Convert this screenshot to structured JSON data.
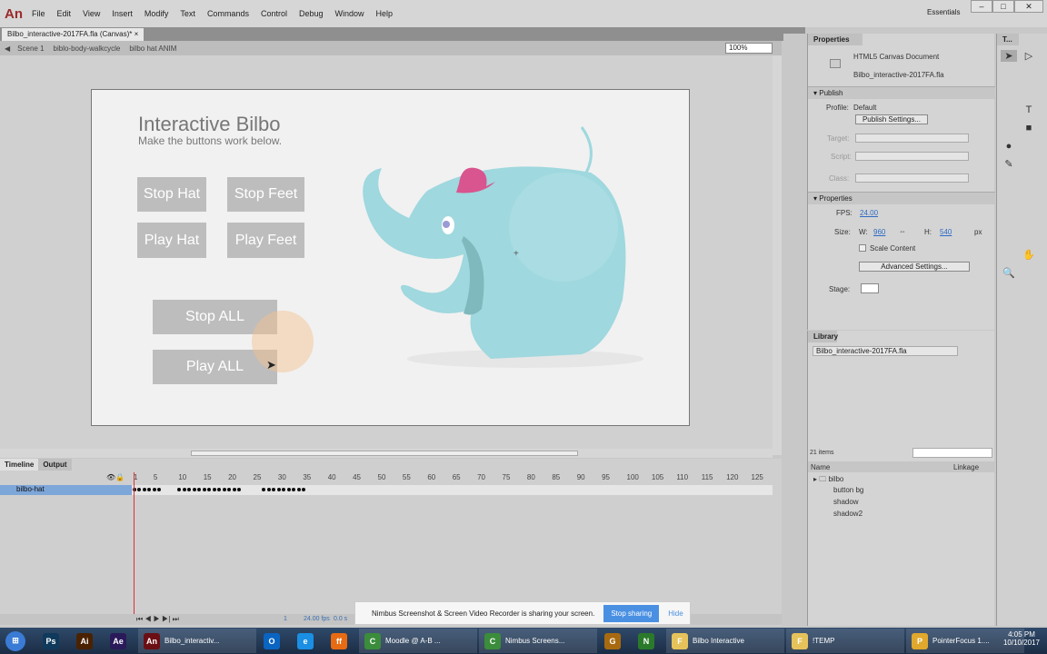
{
  "app": {
    "logo": "An",
    "menu": [
      "File",
      "Edit",
      "View",
      "Insert",
      "Modify",
      "Text",
      "Commands",
      "Control",
      "Debug",
      "Window",
      "Help"
    ],
    "workspace": "Essentials"
  },
  "document": {
    "tab": "Bilbo_interactive-2017FA.fla (Canvas)*",
    "close": "×",
    "breadcrumbs": [
      "Scene 1",
      "biblo-body-walkcycle",
      "bilbo hat ANIM"
    ],
    "zoom": "100%"
  },
  "stage": {
    "title": "Interactive Bilbo",
    "subtitle": "Make the buttons work below.",
    "buttons": [
      "Stop Hat",
      "Stop Feet",
      "Play Hat",
      "Play Feet",
      "Stop ALL",
      "Play ALL"
    ],
    "bg": "#f1f1f1",
    "elephant_color": "#9fd8de",
    "hat_color": "#d9558f"
  },
  "timeline": {
    "tabs": [
      "Timeline",
      "Output"
    ],
    "layer": "bilbo-hat",
    "ruler": [
      "1",
      "5",
      "10",
      "15",
      "20",
      "25",
      "30",
      "35",
      "40",
      "45",
      "50",
      "55",
      "60",
      "65",
      "70",
      "75",
      "80",
      "85",
      "90",
      "95",
      "100",
      "105",
      "110",
      "115",
      "120",
      "125"
    ],
    "current_frame": "1",
    "fps": "24.00 fps",
    "time": "0.0 s"
  },
  "properties": {
    "tab": "Properties",
    "doc_type": "HTML5 Canvas Document",
    "file": "Bilbo_interactive-2017FA.fla",
    "publish": "Publish",
    "profile_label": "Profile:",
    "profile": "Default",
    "publish_settings": "Publish Settings...",
    "target": "Target:",
    "script": "Script:",
    "class": "Class:",
    "properties": "Properties",
    "fps_label": "FPS:",
    "fps": "24.00",
    "size_label": "Size:",
    "w_label": "W:",
    "w": "960",
    "h_label": "H:",
    "h": "540",
    "px": "px",
    "scale": "Scale Content",
    "advanced": "Advanced Settings...",
    "stage_label": "Stage:"
  },
  "library": {
    "tab": "Library",
    "file": "Bilbo_interactive-2017FA.fla",
    "count": "21 items",
    "col_name": "Name",
    "col_linkage": "Linkage",
    "items": [
      "bilbo",
      "button bg",
      "shadow",
      "shadow2"
    ]
  },
  "tools": {
    "tab": "T..."
  },
  "nimbus": {
    "message": "Nimbus Screenshot & Screen Video Recorder is sharing your screen.",
    "stop": "Stop sharing",
    "hide": "Hide"
  },
  "taskbar": {
    "items": [
      {
        "icon": "Ps",
        "color": "#0f3a5c"
      },
      {
        "icon": "Ai",
        "color": "#4a2200"
      },
      {
        "icon": "Ae",
        "color": "#2a1a5a"
      },
      {
        "icon": "An",
        "color": "#6b0f14",
        "label": "Bilbo_interactiv..."
      },
      {
        "icon": "O",
        "color": "#0a64c2"
      },
      {
        "icon": "e",
        "color": "#1a8fe3"
      },
      {
        "icon": "ff",
        "color": "#e76b12"
      },
      {
        "icon": "C",
        "color": "#3b8c3b",
        "label": "Moodle @ A-B ..."
      },
      {
        "icon": "C",
        "color": "#3b8c3b",
        "label": "Nimbus Screens..."
      },
      {
        "icon": "G",
        "color": "#a86a10"
      },
      {
        "icon": "N",
        "color": "#2b7a2b"
      },
      {
        "icon": "F",
        "color": "#e6c25a",
        "label": "Bilbo Interactive"
      },
      {
        "icon": "F",
        "color": "#e6c25a",
        "label": "!TEMP"
      },
      {
        "icon": "P",
        "color": "#e0a82c",
        "label": "PointerFocus 1...."
      }
    ],
    "time": "4:05 PM",
    "date": "10/10/2017"
  }
}
